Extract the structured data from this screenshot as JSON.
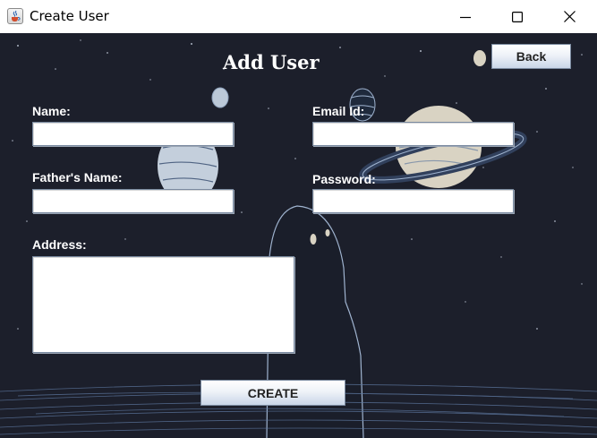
{
  "window": {
    "title": "Create User"
  },
  "form": {
    "heading": "Add User",
    "back_label": "Back",
    "name_label": "Name:",
    "email_label": "Email Id:",
    "father_label": "Father's Name:",
    "password_label": "Password:",
    "address_label": "Address:",
    "create_label": "CREATE",
    "name_value": "",
    "email_value": "",
    "father_value": "",
    "password_value": "",
    "address_value": ""
  },
  "colors": {
    "background": "#1c1f2b",
    "planet": "#d9d3c3",
    "outline": "#9fb3cf"
  }
}
